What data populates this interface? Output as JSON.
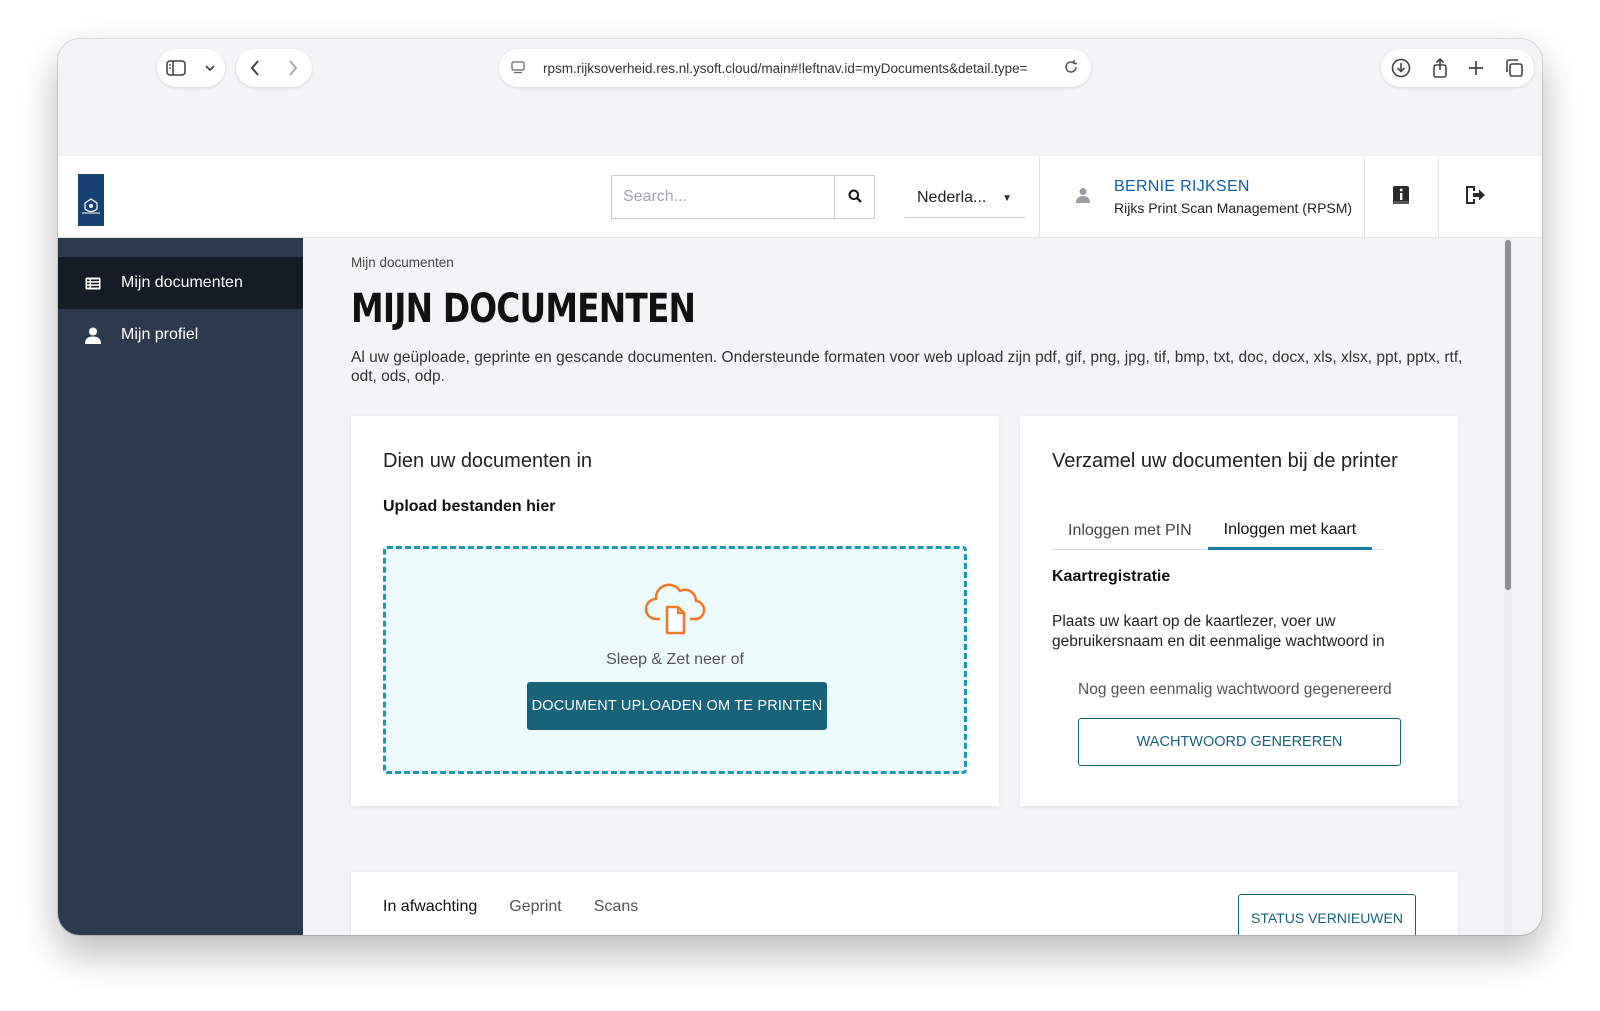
{
  "browser": {
    "url": "rpsm.rijksoverheid.res.nl.ysoft.cloud/main#!leftnav.id=myDocuments&detail.type="
  },
  "header": {
    "search_placeholder": "Search...",
    "language": "Nederla...",
    "user_name": "BERNIE RIJKSEN",
    "user_org": "Rijks Print Scan Management (RPSM)"
  },
  "sidebar": {
    "items": [
      {
        "label": "Mijn documenten",
        "icon": "table-icon",
        "active": true
      },
      {
        "label": "Mijn profiel",
        "icon": "user-icon",
        "active": false
      }
    ]
  },
  "main": {
    "breadcrumb": "Mijn documenten",
    "title": "MIJN DOCUMENTEN",
    "description": "Al uw geüploade, geprinte en gescande documenten. Ondersteunde formaten voor web upload zijn pdf, gif, png, jpg, tif, bmp, txt, doc, docx, xls, xlsx, ppt, pptx, rtf, odt, ods, odp."
  },
  "upload_card": {
    "title": "Dien uw documenten in",
    "subtitle": "Upload bestanden hier",
    "drop_text": "Sleep & Zet neer of",
    "upload_button": "DOCUMENT UPLOADEN OM TE PRINTEN"
  },
  "collect_card": {
    "title": "Verzamel uw documenten bij de printer",
    "tabs": [
      "Inloggen met PIN",
      "Inloggen met kaart"
    ],
    "active_tab": "Inloggen met kaart",
    "section_title": "Kaartregistratie",
    "section_text": "Plaats uw kaart op de kaartlezer, voer uw gebruikersnaam en dit eenmalige wachtwoord in",
    "status_text": "Nog geen eenmalig wachtwoord gegenereerd",
    "generate_button": "WACHTWOORD GENEREREN"
  },
  "documents": {
    "tabs": [
      "In afwachting",
      "Geprint",
      "Scans"
    ],
    "refresh_button": "STATUS VERNIEUWEN"
  },
  "colors": {
    "sidebar_bg": "#2d3a4d",
    "sidebar_active": "#161c25",
    "accent": "#17637a",
    "dropzone_border": "#1c98b1",
    "user_link": "#0d5eaf",
    "cloud_icon": "#f07a28",
    "logo_bg": "#154273"
  }
}
